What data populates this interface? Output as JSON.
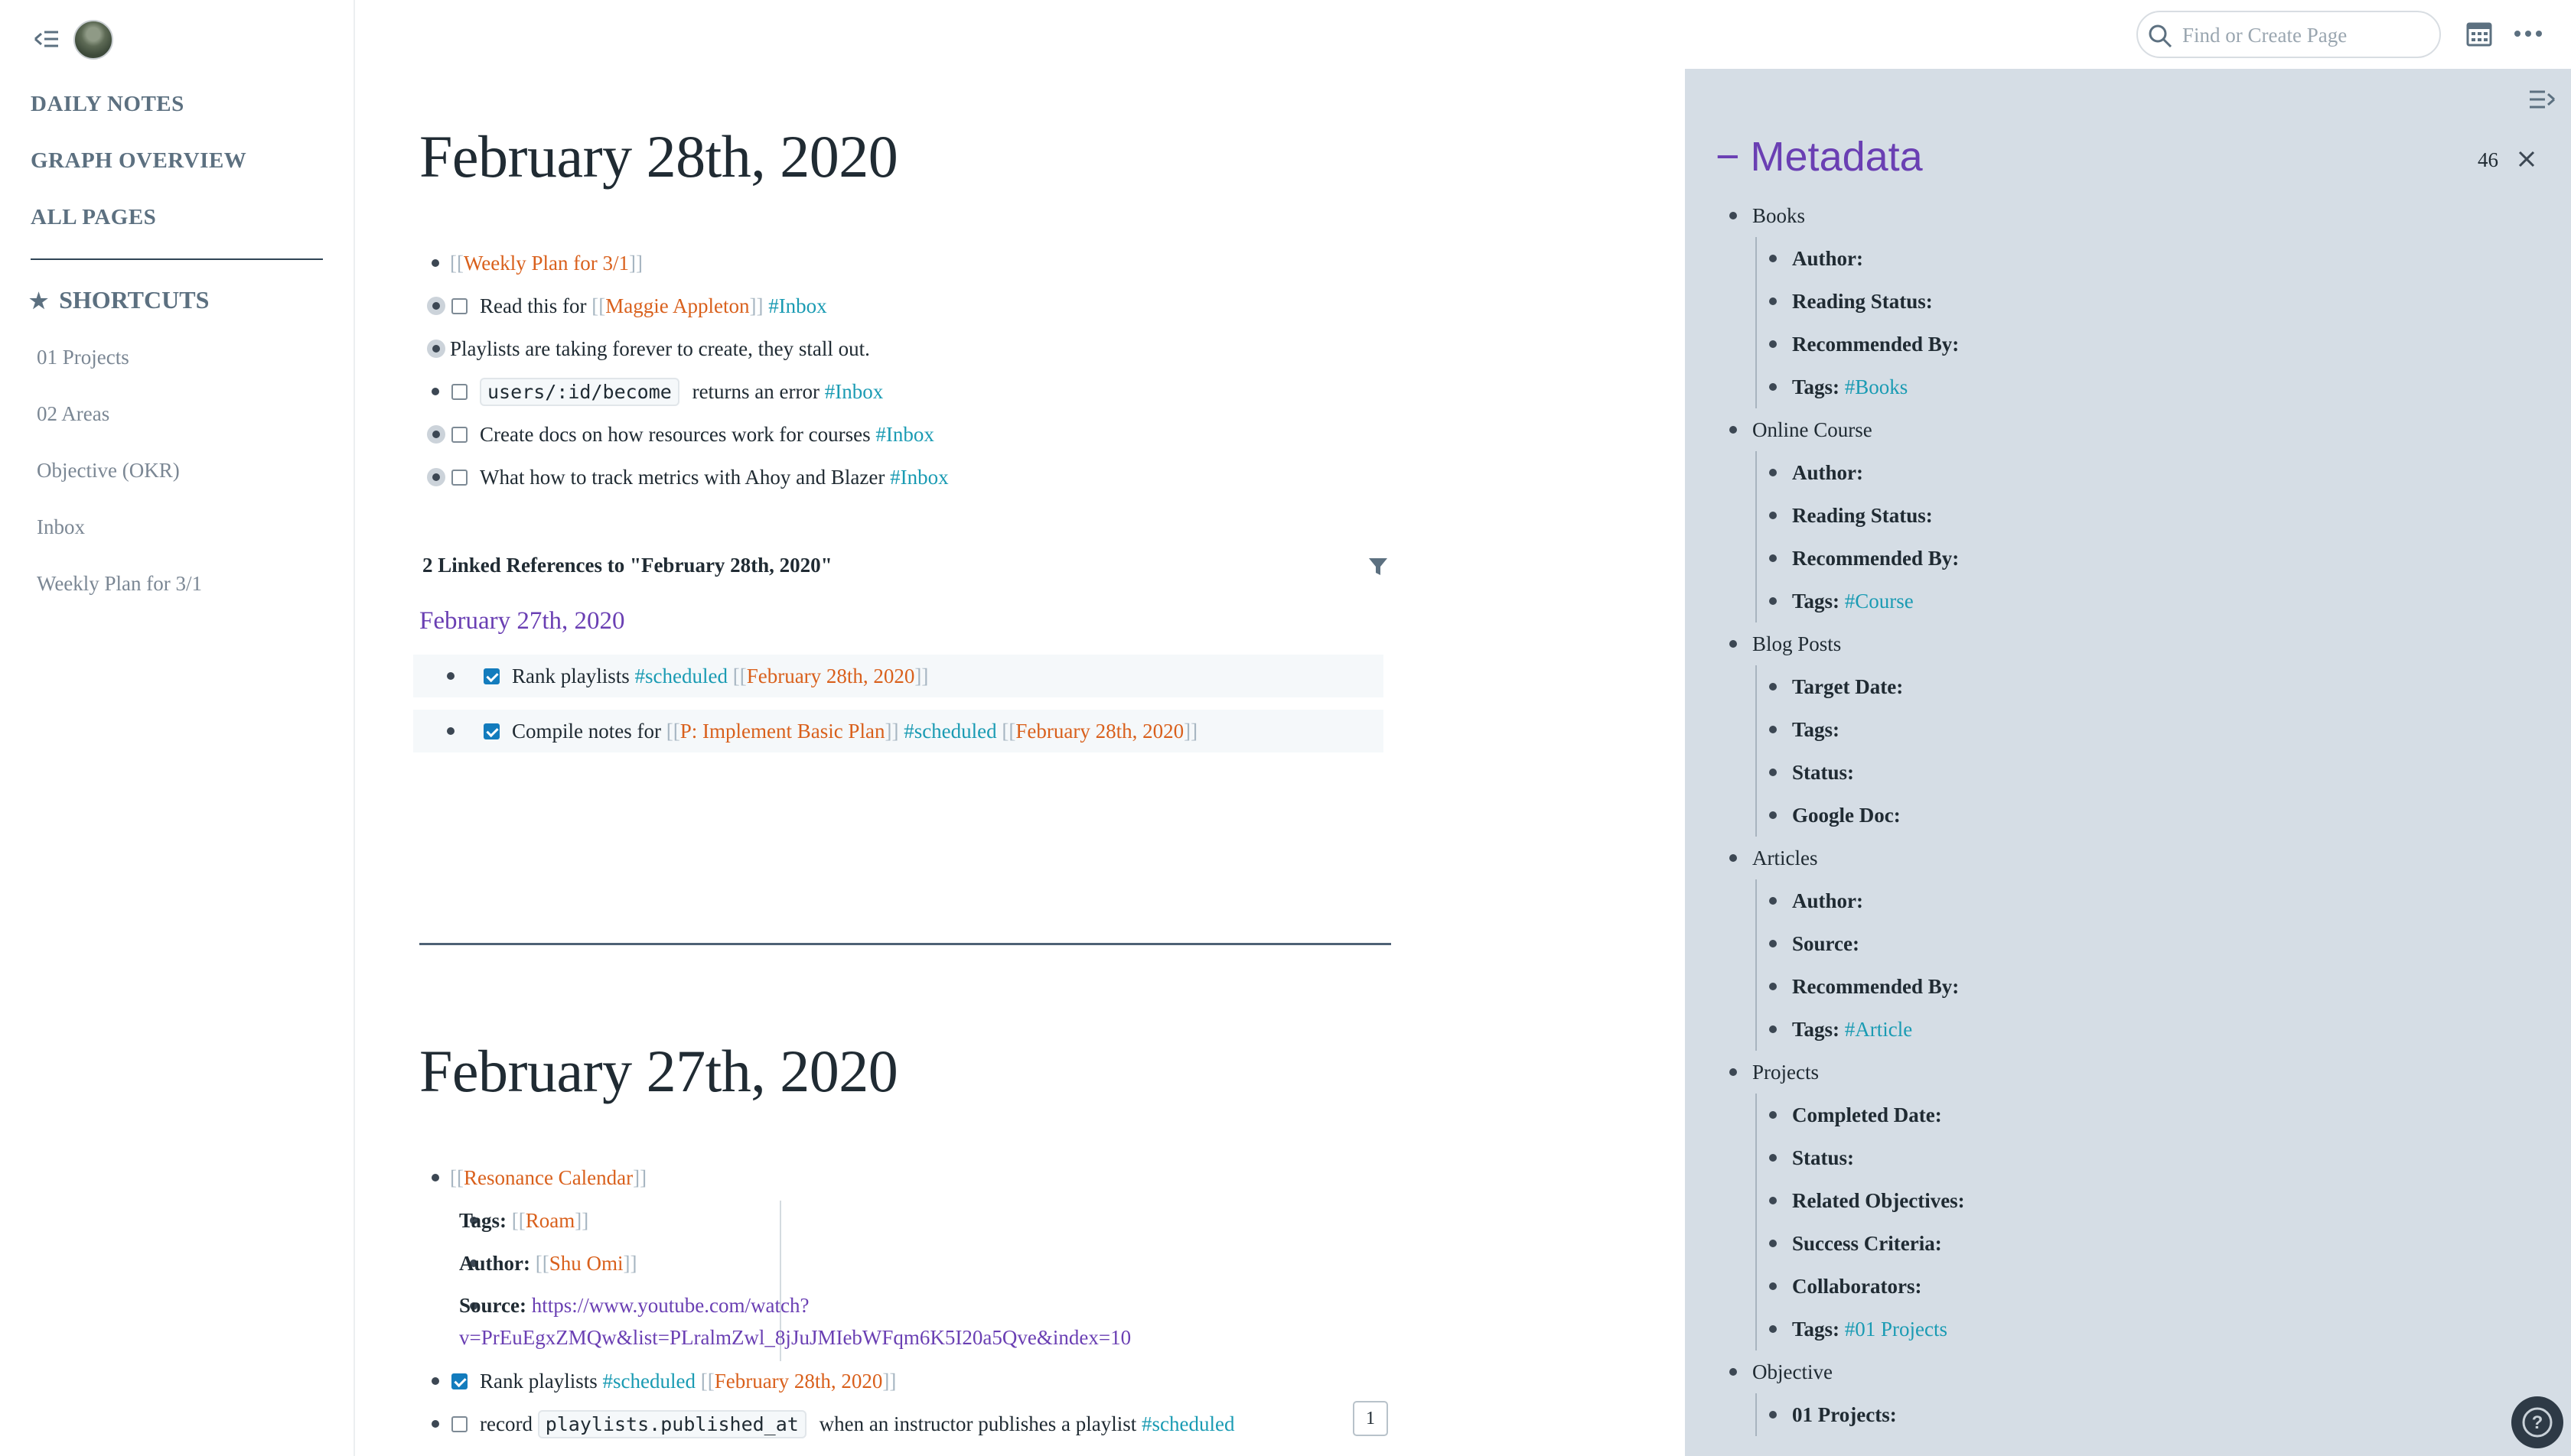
{
  "sidebar": {
    "nav": [
      "DAILY NOTES",
      "GRAPH OVERVIEW",
      "ALL PAGES"
    ],
    "shortcuts_label": "SHORTCUTS",
    "shortcuts": [
      "01 Projects",
      "02 Areas",
      "Objective (OKR)",
      "Inbox",
      "Weekly Plan for 3/1"
    ]
  },
  "topbar": {
    "search_placeholder": "Find or Create Page"
  },
  "page1": {
    "title": "February 28th, 2020",
    "blocks": {
      "b1_link": "Weekly Plan for 3/1",
      "b2_text": "Read this for ",
      "b2_link": "Maggie Appleton",
      "b2_tag": "#Inbox",
      "b3_text": "Playlists are taking forever to create, they stall out.",
      "b4_code": "users/:id/become",
      "b4_text": "returns an error ",
      "b4_tag": "#Inbox",
      "b5_text": "Create docs on how resources work for courses ",
      "b5_tag": "#Inbox",
      "b6_text": "What how to track metrics with Ahoy and Blazer ",
      "b6_tag": "#Inbox"
    },
    "linked_refs": {
      "header": "2 Linked References to \"February 28th, 2020\"",
      "ref_page": "February 27th, 2020",
      "r1_text": "Rank playlists ",
      "r1_tag": "#scheduled",
      "r1_link": "February 28th, 2020",
      "r2_text": "Compile notes for ",
      "r2_link1": "P: Implement Basic Plan",
      "r2_tag": "#scheduled",
      "r2_link2": "February 28th, 2020"
    }
  },
  "page2": {
    "title": "February 27th, 2020",
    "blocks": {
      "c1_link": "Resonance Calendar",
      "tags_label": "Tags:",
      "tags_link": "Roam",
      "author_label": "Author:",
      "author_link": "Shu Omi",
      "source_label": "Source:",
      "source_url_1": "https://www.youtube.com/watch?",
      "source_url_2": "v=PrEuEgxZMQw&list=PLralmZwl_8jJuJMIebWFqm6K5I20a5Qve&index=10",
      "c2_text": "Rank playlists ",
      "c2_tag": "#scheduled",
      "c2_link": "February 28th, 2020",
      "c3_text": "record ",
      "c3_code": "playlists.published_at",
      "c3_text2": "when an instructor publishes a playlist ",
      "c3_tag": "#scheduled",
      "c3_count": "1"
    }
  },
  "metadata": {
    "title": "Metadata",
    "count": "46",
    "groups": [
      {
        "name": "Books",
        "fields": [
          "Author:",
          "Reading Status:",
          "Recommended By:",
          "Tags:"
        ],
        "tag": "#Books"
      },
      {
        "name": "Online Course",
        "fields": [
          "Author:",
          "Reading Status:",
          "Recommended By:",
          "Tags:"
        ],
        "tag": "#Course"
      },
      {
        "name": "Blog Posts",
        "fields": [
          "Target Date:",
          "Tags:",
          "Status:",
          "Google Doc:"
        ],
        "tag": ""
      },
      {
        "name": "Articles",
        "fields": [
          "Author:",
          "Source:",
          "Recommended By:",
          "Tags:"
        ],
        "tag": "#Article"
      },
      {
        "name": "Projects",
        "fields": [
          "Completed Date:",
          "Status:",
          "Related Objectives:",
          "Success Criteria:",
          "Collaborators:",
          "Tags:"
        ],
        "tag": "#01 Projects"
      },
      {
        "name": "Objective",
        "fields": [
          "01 Projects:"
        ],
        "tag": ""
      }
    ]
  }
}
